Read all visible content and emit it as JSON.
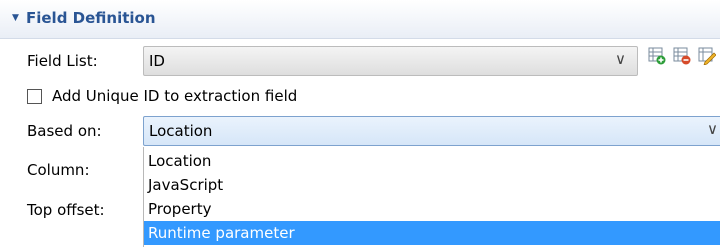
{
  "section": {
    "title": "Field Definition",
    "toggle_icon": "collapse-triangle-icon"
  },
  "field_list": {
    "label": "Field List:",
    "value": "ID",
    "icons": [
      "add-field-icon",
      "remove-field-icon",
      "edit-field-icon"
    ]
  },
  "unique_id": {
    "label": "Add Unique ID to extraction field",
    "checked": false
  },
  "based_on": {
    "label": "Based on:",
    "value": "Location"
  },
  "column": {
    "label": "Column:"
  },
  "top_offset": {
    "label": "Top offset:"
  },
  "dropdown": {
    "options": [
      "Location",
      "JavaScript",
      "Property",
      "Runtime parameter"
    ],
    "selected": "Runtime parameter"
  },
  "colors": {
    "header_text": "#2a5594",
    "selection": "#3399ff",
    "icon_green": "#2e9e3a",
    "icon_red": "#d64b2a"
  }
}
